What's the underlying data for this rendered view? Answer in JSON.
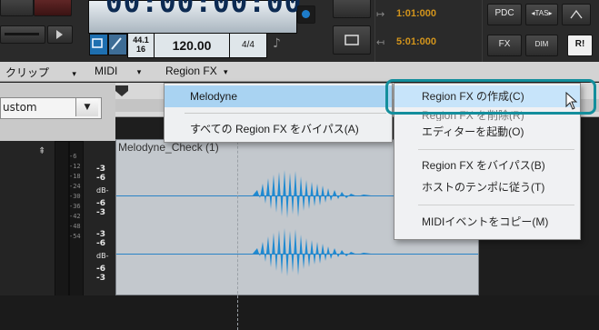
{
  "transport": {
    "counter": "00:00:00:00",
    "sample_rate_top": "44.1",
    "sample_rate_bottom": "16",
    "tempo": "120.00",
    "meter": "4/4",
    "loop_start": "1:01:000",
    "loop_end": "5:01:000",
    "pdc_label": "PDC",
    "fx_label": "FX",
    "tas_label": "TAS",
    "dim_label": "DIM",
    "r_label": "R!"
  },
  "menubar": {
    "items": [
      {
        "label": "クリップ"
      },
      {
        "label": "MIDI"
      },
      {
        "label": "Region FX"
      }
    ]
  },
  "preset": {
    "value": "ustom"
  },
  "clip": {
    "title": "Melodyne_Check (1)"
  },
  "meters": {
    "scale": [
      "-6",
      "-12",
      "-18",
      "-24",
      "-30",
      "-36",
      "-42",
      "-48",
      "-54"
    ],
    "values_top": [
      "-3",
      "-6",
      "dB-",
      "-6",
      "-3"
    ],
    "values_bottom": [
      "-3",
      "-6",
      "dB-",
      "-6",
      "-3"
    ]
  },
  "region_fx_submenu": {
    "items": [
      {
        "label": "Melodyne",
        "highlighted": true
      },
      {
        "label": "すべての Region FX をバイパス(A)",
        "highlighted": false
      }
    ]
  },
  "context_menu": {
    "items": [
      {
        "label": "Region FX の作成(C)",
        "highlighted": true
      },
      {
        "label": "Region FX を削除(R)",
        "highlighted": false
      },
      {
        "label": "エディターを起動(O)",
        "highlighted": false
      },
      {
        "label": "Region FX をバイパス(B)",
        "highlighted": false
      },
      {
        "label": "ホストのテンポに従う(T)",
        "highlighted": false
      },
      {
        "label": "MIDIイベントをコピー(M)",
        "highlighted": false
      }
    ]
  },
  "colors": {
    "accent": "#138e9c",
    "waveform": "#1f8ad1",
    "menu_highlight": "#a9d3f2",
    "counter_text": "#0c2a52",
    "time_orange": "#d2941c"
  }
}
